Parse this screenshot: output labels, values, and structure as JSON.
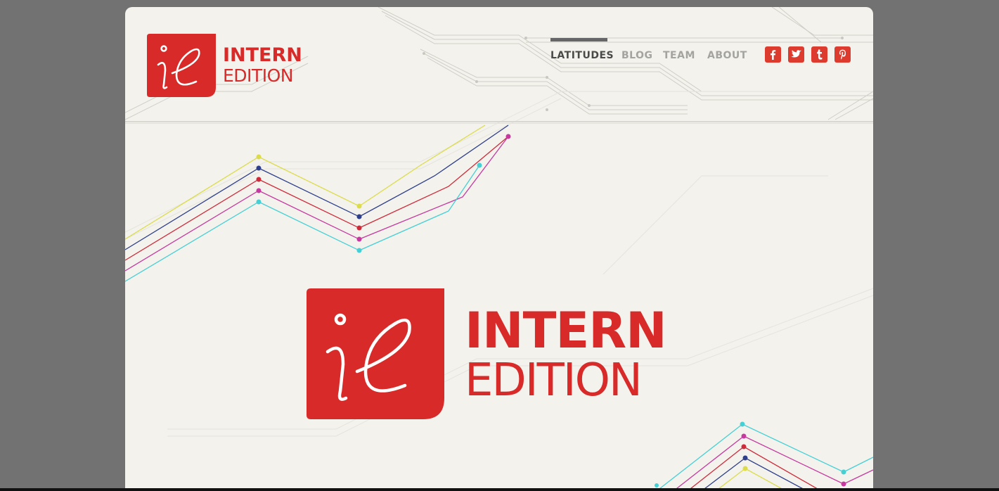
{
  "brand": {
    "logo_mark": "ie",
    "line1": "INTERN",
    "line2": "EDITION"
  },
  "nav": {
    "items": [
      {
        "label": "LATITUDES",
        "active": true
      },
      {
        "label": "BLOG",
        "active": false
      },
      {
        "label": "TEAM",
        "active": false
      },
      {
        "label": "ABOUT",
        "active": false
      }
    ]
  },
  "social": [
    {
      "icon": "facebook-icon",
      "glyph": "f"
    },
    {
      "icon": "twitter-icon",
      "glyph": "bird"
    },
    {
      "icon": "tumblr-icon",
      "glyph": "t"
    },
    {
      "icon": "pinterest-icon",
      "glyph": "p"
    }
  ],
  "hero": {
    "logo_mark": "ie",
    "line1": "INTERN",
    "line2": "EDITION"
  },
  "colors": {
    "brand_red": "#d92a2a",
    "background": "#f3f2ec",
    "outer": "#727272",
    "nav_active": "#4a4a4a",
    "nav_inactive": "#a3a3a0",
    "circuit_lines": [
      "#dcdc4a",
      "#2e3f8c",
      "#cf2a3a",
      "#c63aa0",
      "#45d0d6"
    ]
  }
}
